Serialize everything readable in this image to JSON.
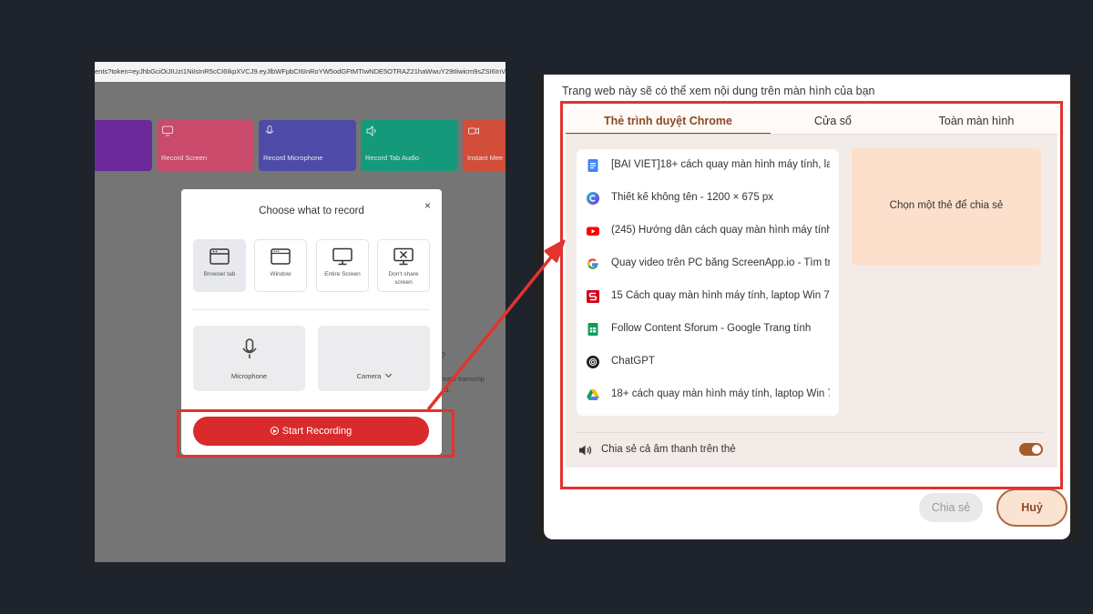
{
  "left": {
    "url_text": "ents?token=eyJhbGciOiJIUzI1NiIsInR5cCI6IkpXVCJ9.eyJlbWFpbCI6InRoYW5odGFtMTIwNDE5OTRAZ21haWwuY29tIiwicm9sZSI6InVzZ",
    "bg_cards": [
      {
        "label": "",
        "color": "#6a2a9a"
      },
      {
        "label": "Record Screen",
        "color": "#c94a6a"
      },
      {
        "label": "Record Microphone",
        "color": "#4e4aa8"
      },
      {
        "label": "Record Tab Audio",
        "color": "#149a7a"
      },
      {
        "label": "Instant Mee",
        "color": "#d24d3a"
      }
    ],
    "bg_side_q": "?",
    "bg_side_text_1": "reate transcrip",
    "bg_side_text_2": "ed.",
    "dialog": {
      "title": "Choose what to record",
      "close": "×",
      "options": [
        {
          "label": "Browser tab",
          "icon": "browser-tab-icon",
          "selected": true
        },
        {
          "label": "Window",
          "icon": "window-icon",
          "selected": false
        },
        {
          "label": "Entire Screen",
          "icon": "monitor-icon",
          "selected": false
        },
        {
          "label": "Don't share screen",
          "icon": "no-share-icon",
          "selected": false
        }
      ],
      "microphone_label": "Microphone",
      "camera_label": "Camera",
      "start_label": "Start Recording"
    }
  },
  "right": {
    "caption": "Trang web này sẽ có thể xem nội dung trên màn hình của bạn",
    "tabs": [
      {
        "label": "Thẻ trình duyệt Chrome",
        "active": true
      },
      {
        "label": "Cửa sổ",
        "active": false
      },
      {
        "label": "Toàn màn hình",
        "active": false
      }
    ],
    "tab_items": [
      {
        "title": "[BÀI VIẾT]18+ cách quay màn hình máy tính, lap",
        "icon": "google-docs-icon"
      },
      {
        "title": "Thiết kế không tên - 1200 × 675 px",
        "icon": "canva-icon"
      },
      {
        "title": "(245) Hướng dẫn cách quay màn hình máy tính",
        "icon": "youtube-icon"
      },
      {
        "title": "Quay video trên PC bằng ScreenApp.io - Tìm trê",
        "icon": "google-icon"
      },
      {
        "title": "15 Cách quay màn hình máy tính, laptop Win 7,",
        "icon": "sforum-icon"
      },
      {
        "title": "Follow Content Sforum - Google Trang tính",
        "icon": "google-sheets-icon"
      },
      {
        "title": "ChatGPT",
        "icon": "chatgpt-icon"
      },
      {
        "title": "18+ cách quay màn hình máy tính, laptop Win 7",
        "icon": "google-drive-icon"
      }
    ],
    "preview_text": "Chọn một thẻ để chia sẻ",
    "audio_label": "Chia sẻ cả âm thanh trên thẻ",
    "audio_on": true,
    "share_label": "Chia sẻ",
    "cancel_label": "Huỷ"
  },
  "colors": {
    "highlight": "#e2332f",
    "accent": "#8a4a22",
    "start_button": "#d92b2b"
  }
}
